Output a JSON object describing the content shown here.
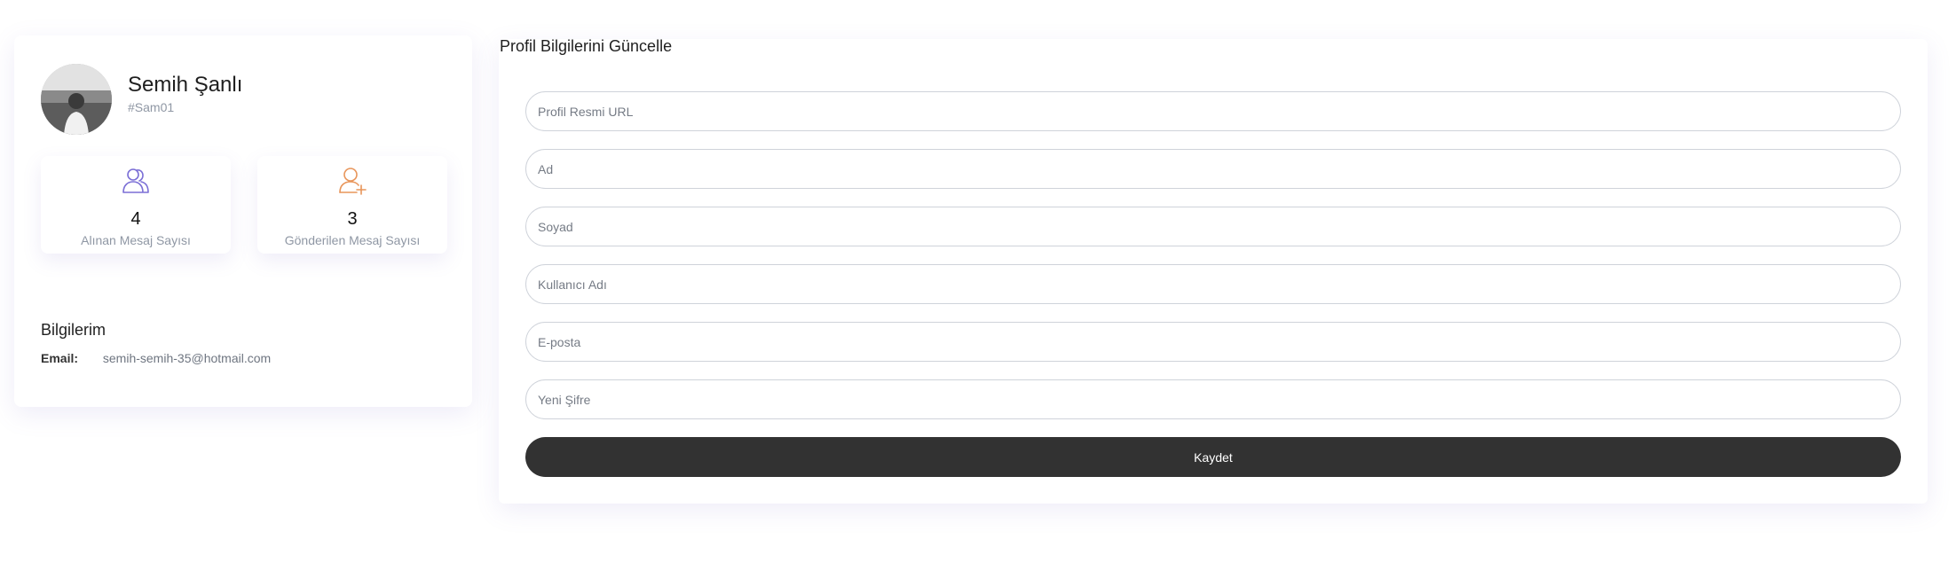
{
  "profile": {
    "name": "Semih Şanlı",
    "handle": "#Sam01",
    "avatar_icon": "user-photo-avatar",
    "stats": [
      {
        "value": "4",
        "label": "Alınan Mesaj Sayısı",
        "icon": "users-icon",
        "color": "#7b6fd6"
      },
      {
        "value": "3",
        "label": "Gönderilen Mesaj Sayısı",
        "icon": "user-plus-icon",
        "color": "#e8955a"
      }
    ],
    "info": {
      "title": "Bilgilerim",
      "email_label": "Email:",
      "email_value": "semih-semih-35@hotmail.com"
    }
  },
  "form": {
    "title": "Profil Bilgilerini Güncelle",
    "fields": [
      {
        "placeholder": "Profil Resmi URL",
        "value": ""
      },
      {
        "placeholder": "Ad",
        "value": ""
      },
      {
        "placeholder": "Soyad",
        "value": ""
      },
      {
        "placeholder": "Kullanıcı Adı",
        "value": ""
      },
      {
        "placeholder": "E-posta",
        "value": ""
      },
      {
        "placeholder": "Yeni Şifre",
        "value": ""
      }
    ],
    "submit_label": "Kaydet"
  },
  "colors": {
    "primary_button": "#323232",
    "stat_icon_received": "#7b6fd6",
    "stat_icon_sent": "#e8955a"
  }
}
